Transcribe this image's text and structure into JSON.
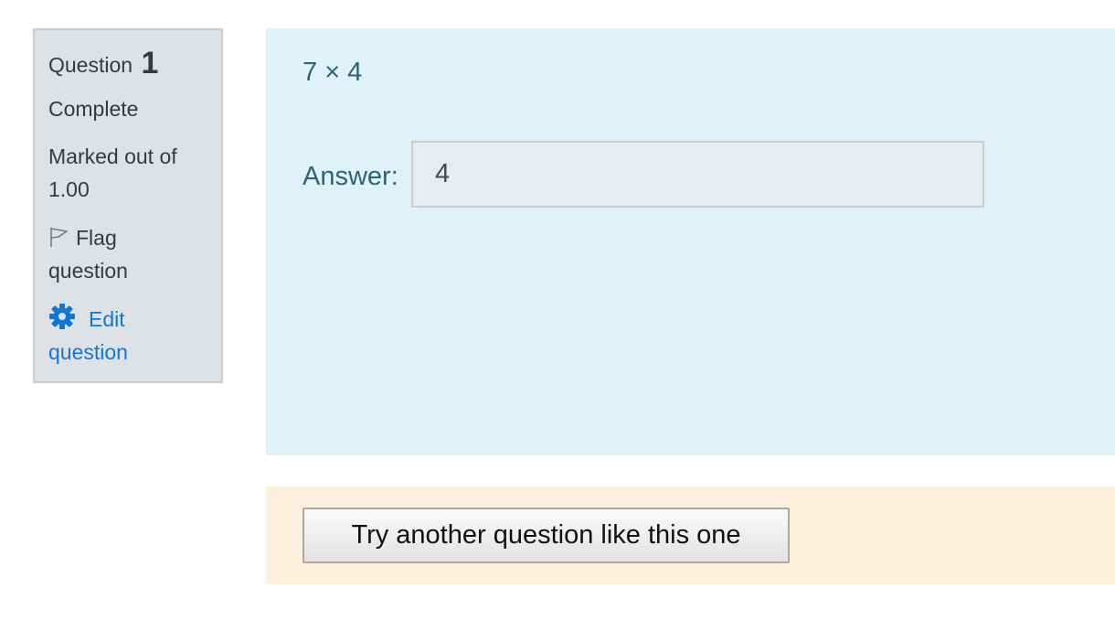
{
  "info": {
    "question_label": "Question",
    "question_number": "1",
    "state": "Complete",
    "grade_line1": "Marked out of",
    "grade_line2": "1.00",
    "flag_line1": "Flag",
    "flag_line2": "question",
    "flag_icon": "flag-outline-icon",
    "edit_line1": "Edit",
    "edit_line2": "question",
    "edit_icon": "gear-icon",
    "link_color": "#1177d1"
  },
  "question": {
    "text": "7 × 4",
    "answer_label": "Answer:",
    "answer_value": "4"
  },
  "actions": {
    "try_another_label": "Try another question like this one"
  },
  "colors": {
    "info_bg": "#dee2e6",
    "content_bg": "#def2f8",
    "actions_bg": "#fcefdc",
    "content_text": "#2f6473"
  }
}
